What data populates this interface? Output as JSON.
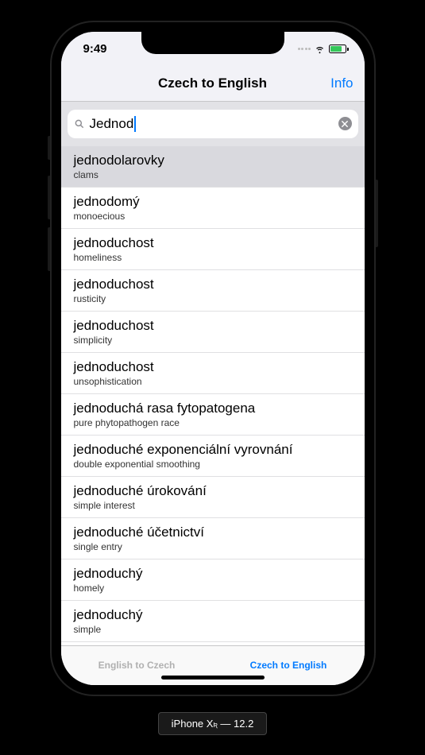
{
  "status": {
    "time": "9:49"
  },
  "nav": {
    "title": "Czech to English",
    "info": "Info"
  },
  "search": {
    "value": "Jednod"
  },
  "results": [
    {
      "cz": "jednodolarovky",
      "en": "clams",
      "selected": true
    },
    {
      "cz": "jednodomý",
      "en": "monoecious",
      "selected": false
    },
    {
      "cz": "jednoduchost",
      "en": "homeliness",
      "selected": false
    },
    {
      "cz": "jednoduchost",
      "en": "rusticity",
      "selected": false
    },
    {
      "cz": "jednoduchost",
      "en": "simplicity",
      "selected": false
    },
    {
      "cz": "jednoduchost",
      "en": "unsophistication",
      "selected": false
    },
    {
      "cz": "jednoduchá rasa fytopatogena",
      "en": "pure phytopathogen race",
      "selected": false
    },
    {
      "cz": "jednoduché exponenciální vyrovnání",
      "en": "double exponential smoothing",
      "selected": false
    },
    {
      "cz": "jednoduché úrokování",
      "en": "simple interest",
      "selected": false
    },
    {
      "cz": "jednoduché účetnictví",
      "en": "single entry",
      "selected": false
    },
    {
      "cz": "jednoduchý",
      "en": "homely",
      "selected": false
    },
    {
      "cz": "jednoduchý",
      "en": "simple",
      "selected": false
    }
  ],
  "tabs": {
    "left": "English to Czech",
    "right": "Czech to English"
  },
  "device": {
    "name": "iPhone X",
    "variant": "ʀ",
    "sep": " — ",
    "os": "12.2"
  }
}
